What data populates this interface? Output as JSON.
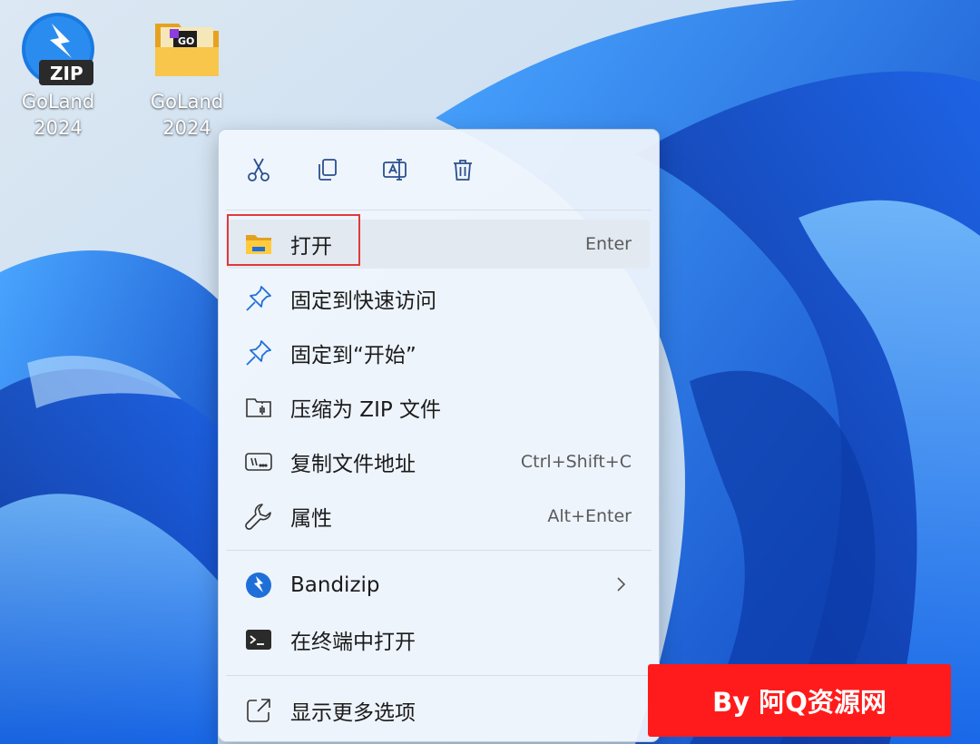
{
  "desktop": {
    "icons": [
      {
        "line1": "GoLand",
        "line2": "2024",
        "type": "bandizip-zip",
        "badge": "ZIP"
      },
      {
        "line1": "GoLand",
        "line2": "2024",
        "type": "folder",
        "badge": "GO"
      }
    ]
  },
  "context_menu": {
    "toolbar": [
      {
        "name": "cut",
        "icon": "scissors-icon"
      },
      {
        "name": "copy",
        "icon": "copy-icon"
      },
      {
        "name": "rename",
        "icon": "rename-icon"
      },
      {
        "name": "delete",
        "icon": "trash-icon"
      }
    ],
    "items": [
      {
        "label": "打开",
        "shortcut": "Enter",
        "icon": "folder-icon"
      },
      {
        "label": "固定到快速访问",
        "shortcut": "",
        "icon": "pin-icon"
      },
      {
        "label": "固定到“开始”",
        "shortcut": "",
        "icon": "pin-icon"
      },
      {
        "label": "压缩为 ZIP 文件",
        "shortcut": "",
        "icon": "zip-folder-icon"
      },
      {
        "label": "复制文件地址",
        "shortcut": "Ctrl+Shift+C",
        "icon": "path-icon"
      },
      {
        "label": "属性",
        "shortcut": "Alt+Enter",
        "icon": "wrench-icon"
      },
      {
        "label": "Bandizip",
        "shortcut": "",
        "icon": "bandizip-icon",
        "has_submenu": true
      },
      {
        "label": "在终端中打开",
        "shortcut": "",
        "icon": "terminal-icon"
      },
      {
        "label": "显示更多选项",
        "shortcut": "",
        "icon": "more-options-icon"
      }
    ]
  },
  "watermark": {
    "text": "By 阿Q资源网"
  },
  "colors": {
    "accent": "#1f6fd8",
    "highlight_box": "#e03a3a",
    "watermark_bg": "#ff1b1b"
  }
}
